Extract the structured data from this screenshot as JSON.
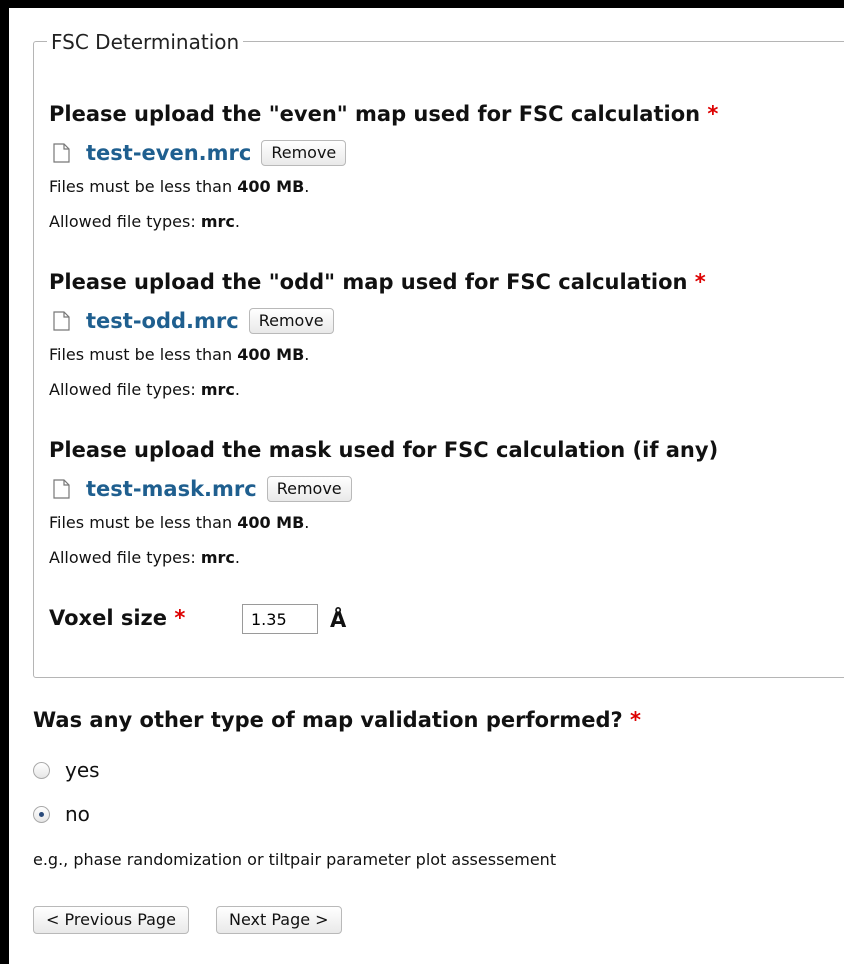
{
  "fieldset": {
    "legend": "FSC Determination"
  },
  "even": {
    "heading": "Please upload the \"even\" map used for FSC calculation",
    "required_mark": "*",
    "filename": "test-even.mrc",
    "remove_label": "Remove",
    "size_prefix": "Files must be less than ",
    "size_value": "400 MB",
    "size_suffix": ".",
    "types_prefix": "Allowed file types: ",
    "types_value": "mrc",
    "types_suffix": "."
  },
  "odd": {
    "heading": "Please upload the \"odd\" map used for FSC calculation",
    "required_mark": "*",
    "filename": "test-odd.mrc",
    "remove_label": "Remove",
    "size_prefix": "Files must be less than ",
    "size_value": "400 MB",
    "size_suffix": ".",
    "types_prefix": "Allowed file types: ",
    "types_value": "mrc",
    "types_suffix": "."
  },
  "mask": {
    "heading": "Please upload the mask used for FSC calculation (if any)",
    "filename": "test-mask.mrc",
    "remove_label": "Remove",
    "size_prefix": "Files must be less than ",
    "size_value": "400 MB",
    "size_suffix": ".",
    "types_prefix": "Allowed file types: ",
    "types_value": "mrc",
    "types_suffix": "."
  },
  "voxel": {
    "label": "Voxel size",
    "required_mark": "*",
    "value": "1.35",
    "unit": "Å"
  },
  "validation": {
    "question": "Was any other type of map validation performed?",
    "required_mark": "*",
    "options": [
      {
        "label": "yes",
        "checked": false
      },
      {
        "label": "no",
        "checked": true
      }
    ],
    "description": "e.g., phase randomization or tiltpair parameter plot assessement"
  },
  "navigation": {
    "previous_label": "< Previous Page",
    "next_label": "Next Page >"
  },
  "colors": {
    "link": "#1f5f8f",
    "required": "#dd0000"
  }
}
